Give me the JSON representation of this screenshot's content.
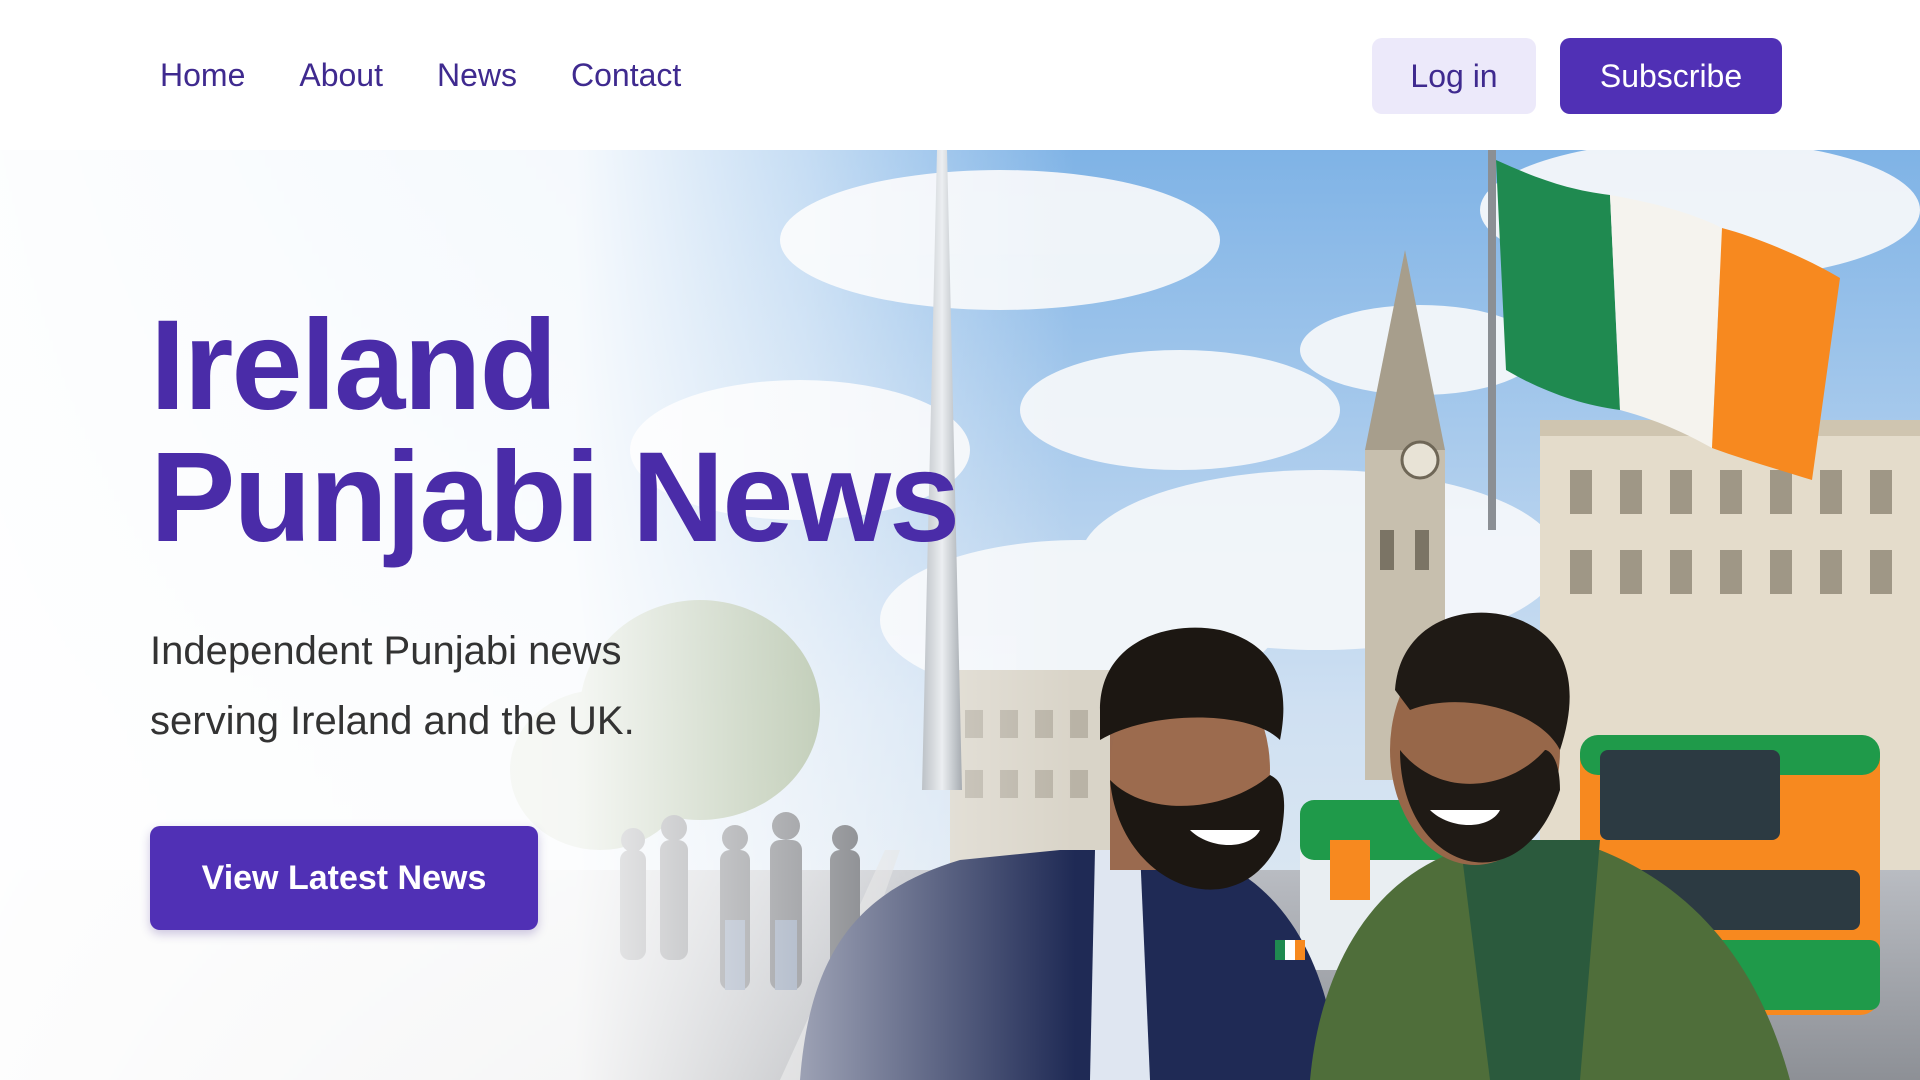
{
  "nav": {
    "links": [
      "Home",
      "About",
      "News",
      "Contact"
    ],
    "login_label": "Log in",
    "subscribe_label": "Subscribe"
  },
  "hero": {
    "title_line1": "Ireland",
    "title_line2": "Punjabi News",
    "subtitle": "Independent Punjabi news serving Ireland and the UK.",
    "cta_label": "View Latest News"
  },
  "colors": {
    "brand": "#5030b5",
    "brand_dark": "#3f2a8f",
    "login_bg": "#ece9fa",
    "flag_green": "#1f8a50",
    "flag_orange": "#f7891f"
  }
}
